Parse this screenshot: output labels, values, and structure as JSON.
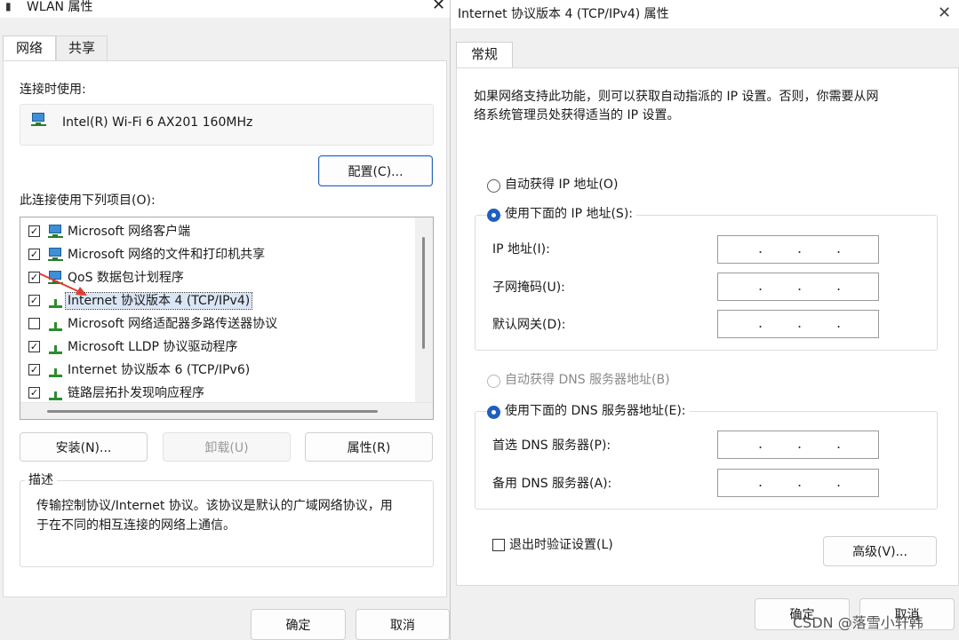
{
  "wlan_dialog": {
    "title": "WLAN 属性",
    "tabs": [
      {
        "label": "网络",
        "active": true
      },
      {
        "label": "共享",
        "active": false
      }
    ],
    "connect_using_label": "连接时使用:",
    "adapter_name": "Intel(R) Wi-Fi 6 AX201 160MHz",
    "configure_button": "配置(C)...",
    "items_label": "此连接使用下列项目(O):",
    "items": [
      {
        "label": "Microsoft 网络客户端",
        "checked": true,
        "icon": "network-client-icon"
      },
      {
        "label": "Microsoft 网络的文件和打印机共享",
        "checked": true,
        "icon": "file-printer-sharing-icon"
      },
      {
        "label": "QoS 数据包计划程序",
        "checked": true,
        "icon": "qos-icon"
      },
      {
        "label": "Internet 协议版本 4 (TCP/IPv4)",
        "checked": true,
        "selected": true,
        "icon": "protocol-icon"
      },
      {
        "label": "Microsoft 网络适配器多路传送器协议",
        "checked": false,
        "icon": "protocol-icon"
      },
      {
        "label": "Microsoft LLDP 协议驱动程序",
        "checked": true,
        "icon": "protocol-icon"
      },
      {
        "label": "Internet 协议版本 6 (TCP/IPv6)",
        "checked": true,
        "icon": "protocol-icon"
      },
      {
        "label": "链路层拓扑发现响应程序",
        "checked": true,
        "icon": "protocol-icon"
      }
    ],
    "install_button": "安装(N)...",
    "uninstall_button": "卸载(U)",
    "properties_button": "属性(R)",
    "description_title": "描述",
    "description_text_line1": "传输控制协议/Internet 协议。该协议是默认的广域网络协议，用",
    "description_text_line2": "于在不同的相互连接的网络上通信。",
    "ok_button": "确定",
    "cancel_button": "取消"
  },
  "ipv4_dialog": {
    "title": "Internet 协议版本 4 (TCP/IPv4) 属性",
    "tab": "常规",
    "intro_line1": "如果网络支持此功能，则可以获取自动指派的 IP 设置。否则，你需要从网",
    "intro_line2": "络系统管理员处获得适当的 IP 设置。",
    "auto_ip_label": "自动获得 IP 地址(O)",
    "manual_ip_label": "使用下面的 IP 地址(S):",
    "ip_address_label": "IP 地址(I):",
    "subnet_mask_label": "子网掩码(U):",
    "gateway_label": "默认网关(D):",
    "auto_dns_label": "自动获得 DNS 服务器地址(B)",
    "manual_dns_label": "使用下面的 DNS 服务器地址(E):",
    "preferred_dns_label": "首选 DNS 服务器(P):",
    "alternate_dns_label": "备用 DNS 服务器(A):",
    "validate_on_exit_label": "退出时验证设置(L)",
    "advanced_button": "高级(V)...",
    "ok_button": "确定",
    "cancel_button": "取消",
    "ip_dot": "."
  },
  "watermark": "CSDN @落雪小轩韩",
  "colors": {
    "radio_selected": "#1f5fbf",
    "button_focus_border": "#2c63b8",
    "selection_highlight": "#dbe6f5",
    "annotation_arrow": "#e23b2e"
  }
}
